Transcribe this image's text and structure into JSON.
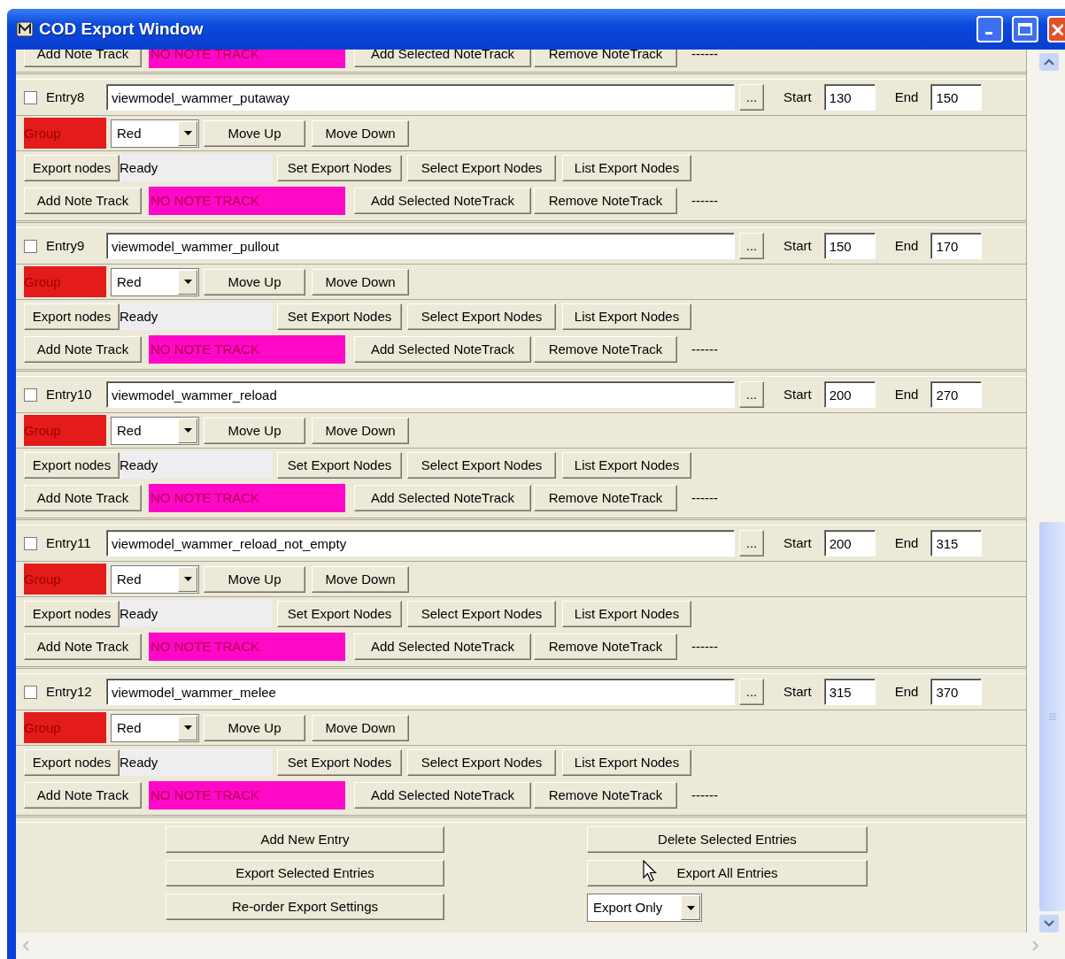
{
  "window": {
    "title": "COD Export Window"
  },
  "partial_row": {
    "add_button": "Add Note Track",
    "note_track": "NO NOTE TRACK",
    "add_selected_button": "Add Selected NoteTrack",
    "remove_button": "Remove NoteTrack",
    "dashes": "------"
  },
  "entries": [
    {
      "checked": false,
      "label": "Entry8",
      "name": "viewmodel_wammer_putaway",
      "browse_button": "...",
      "start_label": "Start",
      "start": "130",
      "end_label": "End",
      "end": "150",
      "group_label": "Group",
      "group": "Red",
      "move_up": "Move Up",
      "move_down": "Move Down",
      "export_nodes_button": "Export nodes",
      "export_status": "Ready",
      "set_button": "Set Export Nodes",
      "select_button": "Select Export Nodes",
      "list_button": "List Export Nodes",
      "note_row": {
        "add_button": "Add Note Track",
        "note_track": "NO NOTE TRACK",
        "add_selected_button": "Add Selected NoteTrack",
        "remove_button": "Remove NoteTrack",
        "dashes": "------"
      }
    },
    {
      "checked": false,
      "label": "Entry9",
      "name": "viewmodel_wammer_pullout",
      "browse_button": "...",
      "start_label": "Start",
      "start": "150",
      "end_label": "End",
      "end": "170",
      "group_label": "Group",
      "group": "Red",
      "move_up": "Move Up",
      "move_down": "Move Down",
      "export_nodes_button": "Export nodes",
      "export_status": "Ready",
      "set_button": "Set Export Nodes",
      "select_button": "Select Export Nodes",
      "list_button": "List Export Nodes",
      "note_row": {
        "add_button": "Add Note Track",
        "note_track": "NO NOTE TRACK",
        "add_selected_button": "Add Selected NoteTrack",
        "remove_button": "Remove NoteTrack",
        "dashes": "------"
      }
    },
    {
      "checked": false,
      "label": "Entry10",
      "name": "viewmodel_wammer_reload",
      "browse_button": "...",
      "start_label": "Start",
      "start": "200",
      "end_label": "End",
      "end": "270",
      "group_label": "Group",
      "group": "Red",
      "move_up": "Move Up",
      "move_down": "Move Down",
      "export_nodes_button": "Export nodes",
      "export_status": "Ready",
      "set_button": "Set Export Nodes",
      "select_button": "Select Export Nodes",
      "list_button": "List Export Nodes",
      "note_row": {
        "add_button": "Add Note Track",
        "note_track": "NO NOTE TRACK",
        "add_selected_button": "Add Selected NoteTrack",
        "remove_button": "Remove NoteTrack",
        "dashes": "------"
      }
    },
    {
      "checked": false,
      "label": "Entry11",
      "name": "viewmodel_wammer_reload_not_empty",
      "browse_button": "...",
      "start_label": "Start",
      "start": "200",
      "end_label": "End",
      "end": "315",
      "group_label": "Group",
      "group": "Red",
      "move_up": "Move Up",
      "move_down": "Move Down",
      "export_nodes_button": "Export nodes",
      "export_status": "Ready",
      "set_button": "Set Export Nodes",
      "select_button": "Select Export Nodes",
      "list_button": "List Export Nodes",
      "note_row": {
        "add_button": "Add Note Track",
        "note_track": "NO NOTE TRACK",
        "add_selected_button": "Add Selected NoteTrack",
        "remove_button": "Remove NoteTrack",
        "dashes": "------"
      }
    },
    {
      "checked": false,
      "label": "Entry12",
      "name": "viewmodel_wammer_melee",
      "browse_button": "...",
      "start_label": "Start",
      "start": "315",
      "end_label": "End",
      "end": "370",
      "group_label": "Group",
      "group": "Red",
      "move_up": "Move Up",
      "move_down": "Move Down",
      "export_nodes_button": "Export nodes",
      "export_status": "Ready",
      "set_button": "Set Export Nodes",
      "select_button": "Select Export Nodes",
      "list_button": "List Export Nodes",
      "note_row": {
        "add_button": "Add Note Track",
        "note_track": "NO NOTE TRACK",
        "add_selected_button": "Add Selected NoteTrack",
        "remove_button": "Remove NoteTrack",
        "dashes": "------"
      }
    }
  ],
  "footer": {
    "add_new": "Add New Entry",
    "delete_selected": "Delete Selected Entries",
    "export_selected": "Export Selected Entries",
    "export_all": "Export All Entries",
    "reorder": "Re-order Export Settings",
    "export_mode": "Export Only"
  }
}
